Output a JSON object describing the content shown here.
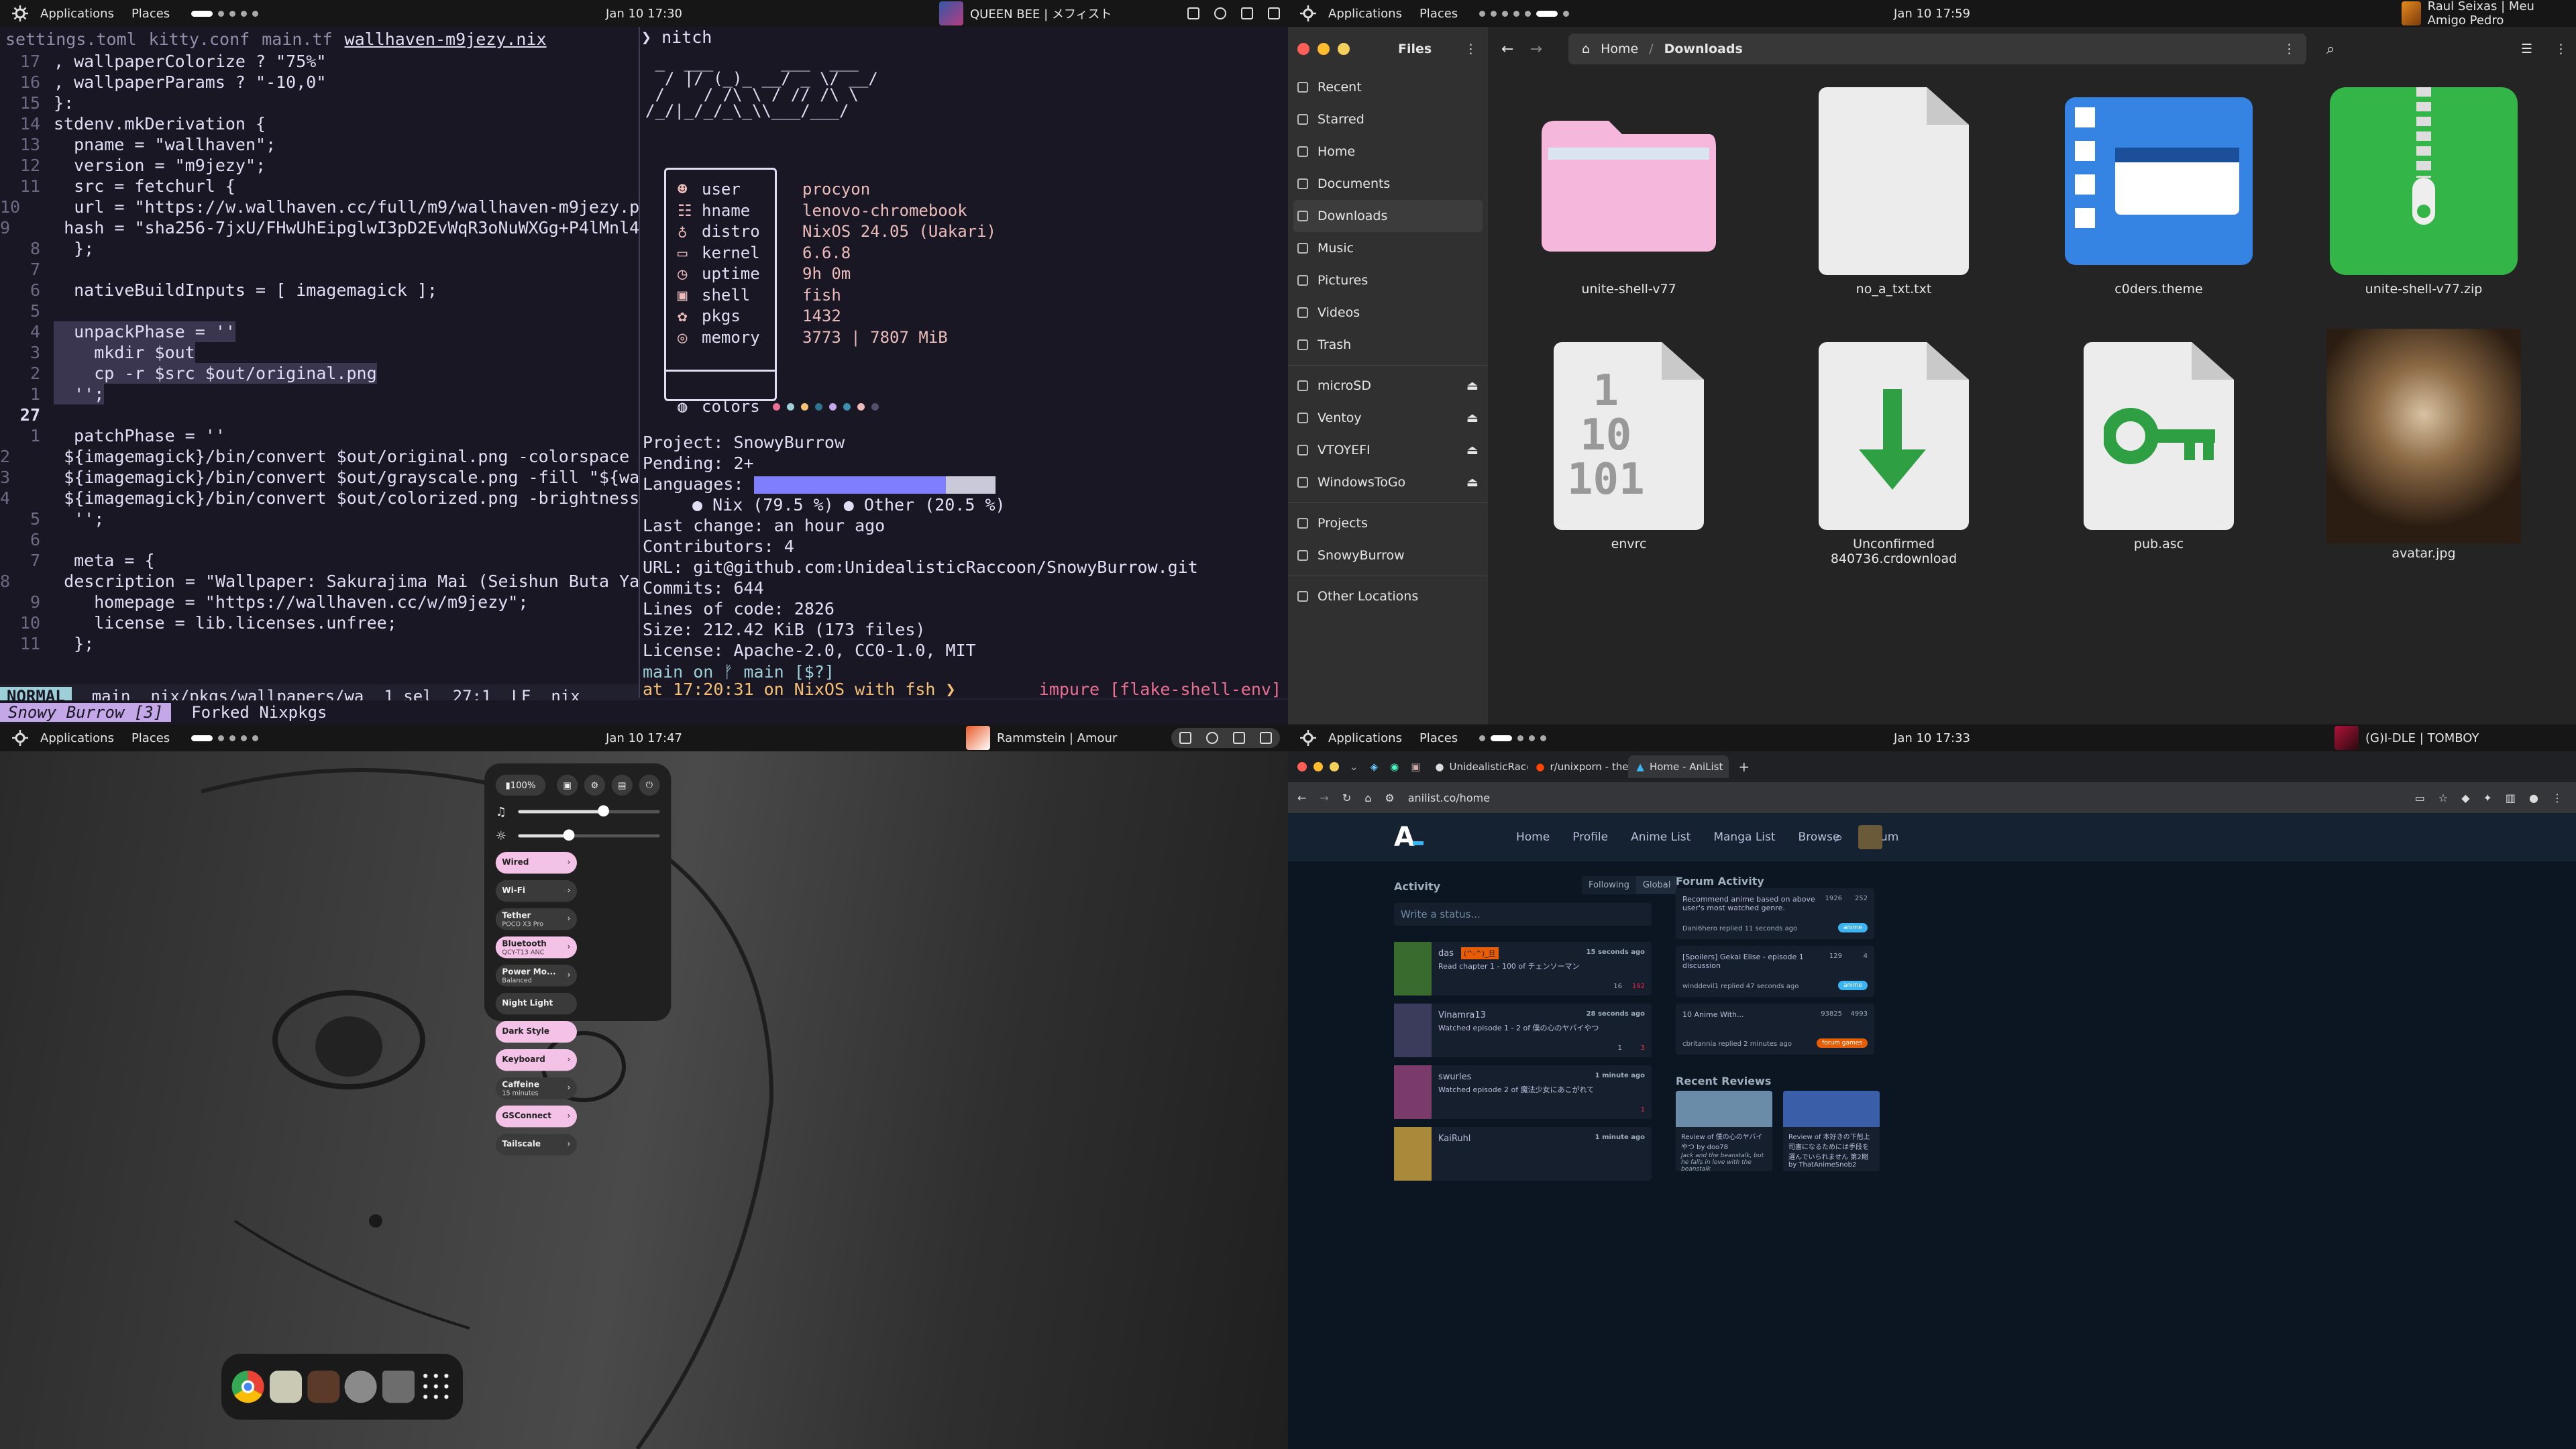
{
  "q1": {
    "topbar": {
      "applications": "Applications",
      "places": "Places",
      "clock": "Jan 10 17:30",
      "media": "QUEEN BEE | メフィスト"
    },
    "editor": {
      "tabs": [
        "settings.toml",
        "kitty.conf",
        "main.tf",
        "wallhaven-m9jezy.nix"
      ],
      "lines": [
        {
          "n": "17",
          "t": ", wallpaperColorize ? \"75%\""
        },
        {
          "n": "16",
          "t": ", wallpaperParams ? \"-10,0\""
        },
        {
          "n": "15",
          "t": "}:"
        },
        {
          "n": "14",
          "t": "stdenv.mkDerivation {"
        },
        {
          "n": "13",
          "t": "  pname = \"wallhaven\";"
        },
        {
          "n": "12",
          "t": "  version = \"m9jezy\";"
        },
        {
          "n": "11",
          "t": "  src = fetchurl {"
        },
        {
          "n": "10",
          "t": "    url = \"https://w.wallhaven.cc/full/m9/wallhaven-m9jezy.png"
        },
        {
          "n": "9",
          "t": "    hash = \"sha256-7jxU/FHwUhEipglwI3pD2EvWqR3oNuWXGg+P4lMnl4Y"
        },
        {
          "n": "8",
          "t": "  };"
        },
        {
          "n": "7",
          "t": ""
        },
        {
          "n": "6",
          "t": "  nativeBuildInputs = [ imagemagick ];"
        },
        {
          "n": "5",
          "t": ""
        },
        {
          "n": "4",
          "t": "  unpackPhase = ''"
        },
        {
          "n": "3",
          "t": "    mkdir $out"
        },
        {
          "n": "2",
          "t": "    cp -r $src $out/original.png"
        },
        {
          "n": "1",
          "t": "  '';"
        },
        {
          "n": "27",
          "t": ""
        },
        {
          "n": "1",
          "t": "  patchPhase = ''"
        },
        {
          "n": "2",
          "t": "    ${imagemagick}/bin/convert $out/original.png -colorspace G"
        },
        {
          "n": "3",
          "t": "    ${imagemagick}/bin/convert $out/grayscale.png -fill \"${wal"
        },
        {
          "n": "4",
          "t": "    ${imagemagick}/bin/convert $out/colorized.png -brightness-"
        },
        {
          "n": "5",
          "t": "  '';"
        },
        {
          "n": "6",
          "t": ""
        },
        {
          "n": "7",
          "t": "  meta = {"
        },
        {
          "n": "8",
          "t": "    description = \"Wallpaper: Sakurajima Mai (Seishun Buta Yar"
        },
        {
          "n": "9",
          "t": "    homepage = \"https://wallhaven.cc/w/m9jezy\";"
        },
        {
          "n": "10",
          "t": "    license = lib.licenses.unfree;"
        },
        {
          "n": "11",
          "t": "  };"
        }
      ],
      "status": {
        "mode": "NORMAL",
        "branch": "main",
        "path": "nix/pkgs/wallpapers/wa",
        "sel": "1 sel",
        "pos": "27:1",
        "eol": "LF",
        "lang": "nix"
      }
    },
    "kittybar": {
      "active": "Snowy Burrow [3]",
      "other": "Forked Nixpkgs"
    },
    "terminal": {
      "cmd": "❯ nitch",
      "ascii": [
        " _  ___       ___  ___",
        "  / |/ (_)_ __/ _ \\/ __/",
        " /    / /\\ \\ / // /\\ \\",
        "/_/|_/_/_\\_\\\\___/___/"
      ],
      "nitch": [
        {
          "label": "user",
          "value": "procyon"
        },
        {
          "label": "hname",
          "value": "lenovo-chromebook"
        },
        {
          "label": "distro",
          "value": "NixOS 24.05 (Uakari)"
        },
        {
          "label": "kernel",
          "value": "6.6.8"
        },
        {
          "label": "uptime",
          "value": "9h 0m"
        },
        {
          "label": "shell",
          "value": "fish"
        },
        {
          "label": "pkgs",
          "value": "1432"
        },
        {
          "label": "memory",
          "value": "3773 | 7807 MiB"
        }
      ],
      "colors_label": "colors",
      "onefetch": {
        "project": "Project: SnowyBurrow",
        "pending": "Pending: 2+",
        "languages": "Languages:",
        "nix_share": 79.5,
        "lang_legend": "● Nix (79.5 %) ● Other (20.5 %)",
        "last_change": "Last change: an hour ago",
        "contributors": "Contributors: 4",
        "url": "URL: git@github.com:UnidealisticRaccoon/SnowyBurrow.git",
        "commits": "Commits: 644",
        "loc": "Lines of code: 2826",
        "size": "Size: 212.42 KiB (173 files)",
        "license": "License: Apache-2.0, CC0-1.0, MIT"
      },
      "prompt1": "main on ᚠ main [$?]",
      "prompt_right": "impure [flake-shell-env]",
      "prompt2": "at 17:20:31 on NixOS with fsh ❯"
    }
  },
  "q2": {
    "topbar": {
      "applications": "Applications",
      "places": "Places",
      "clock": "Jan 10 17:59",
      "media": "Raul Seixas | Meu Amigo Pedro"
    },
    "files": {
      "title": "Files",
      "sidebar": [
        "Recent",
        "Starred",
        "Home",
        "Documents",
        "Downloads",
        "Music",
        "Pictures",
        "Videos",
        "Trash",
        "microSD",
        "Ventoy",
        "VTOYEFI",
        "WindowsToGo",
        "Projects",
        "SnowyBurrow",
        "Other Locations"
      ],
      "path": [
        "Home",
        "Downloads"
      ],
      "items": [
        "unite-shell-v77",
        "no_a_txt.txt",
        "c0ders.theme",
        "unite-shell-v77.zip",
        "envrc",
        "Unconfirmed 840736.crdownload",
        "pub.asc",
        "avatar.jpg"
      ],
      "accent": "#3584e4"
    }
  },
  "q3": {
    "topbar": {
      "applications": "Applications",
      "places": "Places",
      "clock": "Jan 10 17:47",
      "media": "Rammstein | Amour"
    },
    "quick": {
      "battery": "100%",
      "volume_level": 0.6,
      "brightness_level": 0.36,
      "tiles": [
        {
          "title": "Wired",
          "sub": "",
          "on": true,
          "arrow": true
        },
        {
          "title": "Wi-Fi",
          "sub": "",
          "on": false,
          "arrow": true
        },
        {
          "title": "Tether",
          "sub": "POCO X3 Pro",
          "on": false,
          "arrow": true
        },
        {
          "title": "Bluetooth",
          "sub": "QCY-T13 ANC",
          "on": true,
          "arrow": true
        },
        {
          "title": "Power Mo...",
          "sub": "Balanced",
          "on": false,
          "arrow": true
        },
        {
          "title": "Night Light",
          "sub": "",
          "on": false,
          "arrow": false
        },
        {
          "title": "Dark Style",
          "sub": "",
          "on": true,
          "arrow": false
        },
        {
          "title": "Keyboard",
          "sub": "",
          "on": true,
          "arrow": true
        },
        {
          "title": "Caffeine",
          "sub": "15 minutes",
          "on": false,
          "arrow": true
        },
        {
          "title": "GSConnect",
          "sub": "",
          "on": true,
          "arrow": true
        },
        {
          "title": "Tailscale",
          "sub": "",
          "on": false,
          "arrow": true
        }
      ]
    },
    "dock": [
      "chrome-icon",
      "files-icon",
      "terminal-icon",
      "settings-icon",
      "trash-icon",
      "app-grid-icon"
    ]
  },
  "q4": {
    "topbar": {
      "applications": "Applications",
      "places": "Places",
      "clock": "Jan 10 17:33",
      "media": "(G)I-DLE | TOMBOY"
    },
    "browser": {
      "tabs": [
        "UnidealisticRaccoon (Un",
        "r/unixporn - the home fo",
        "Home - AniList"
      ],
      "url": "anilist.co/home",
      "logo": "A",
      "nav": [
        "Home",
        "Profile",
        "Anime List",
        "Manga List",
        "Browse",
        "Forum"
      ],
      "activity_title": "Activity",
      "filters": [
        "Following",
        "Global"
      ],
      "status_placeholder": "Write a status...",
      "activity": [
        {
          "user": "das",
          "tag": "(^-^)_旦",
          "time": "15 seconds ago",
          "text": "Read chapter 1 - 100 of チェンソーマン",
          "replies": "16",
          "likes": "192"
        },
        {
          "user": "Vinamra13",
          "tag": "",
          "time": "28 seconds ago",
          "text": "Watched episode 1 - 2 of 僕の心のヤバイやつ",
          "replies": "1",
          "likes": "3"
        },
        {
          "user": "swurles",
          "tag": "",
          "time": "1 minute ago",
          "text": "Watched episode 2 of 魔法少女にあこがれて",
          "replies": "",
          "likes": "1"
        },
        {
          "user": "KaiRuhl",
          "tag": "",
          "time": "1 minute ago",
          "text": "",
          "replies": "",
          "likes": ""
        }
      ],
      "forum_title": "Forum Activity",
      "forum": [
        {
          "title": "Recommend anime based on above user's most watched genre.",
          "views": "1926",
          "replies": "252",
          "by": "Dani6hero replied 11 seconds ago",
          "tag": "anime"
        },
        {
          "title": "[Spoilers] Gekai Elise - episode 1 discussion",
          "views": "129",
          "replies": "4",
          "by": "winddevil1 replied 47 seconds ago",
          "tag": "anime"
        },
        {
          "title": "10 Anime With...",
          "views": "93825",
          "replies": "4993",
          "by": "cbritannia replied 2 minutes ago",
          "tag": "forum games"
        }
      ],
      "reviews_title": "Recent Reviews",
      "reviews": [
        {
          "title": "Review of 僕の心のヤバイやつ by doo78",
          "snippet": "Jack and the beanstalk, but he falls in love with the beanstalk"
        },
        {
          "title": "Review of 本好きの下剋上 司書になるためには手段を選んでいられません 第2期 by ThatAnimeSnob2",
          "snippet": ""
        }
      ]
    }
  }
}
